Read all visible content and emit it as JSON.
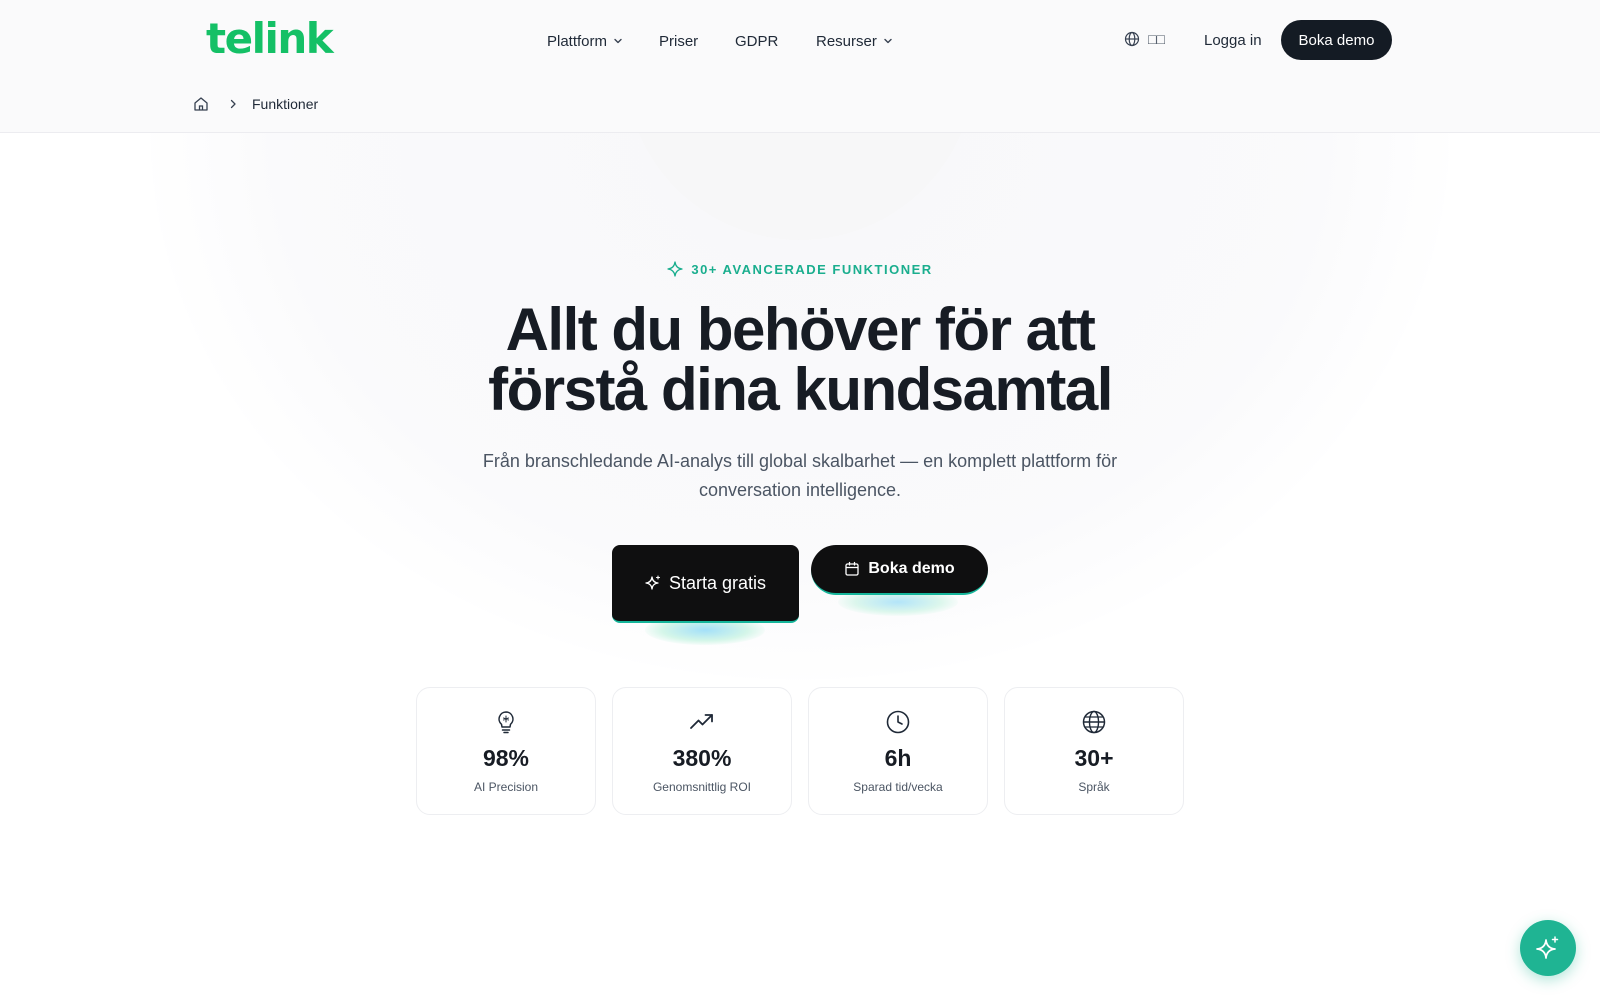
{
  "brand": {
    "logo_text": "telink",
    "color": "#14c066",
    "accent": "#1aae8e"
  },
  "nav": {
    "items": [
      {
        "label": "Plattform",
        "has_dropdown": true
      },
      {
        "label": "Priser",
        "has_dropdown": false
      },
      {
        "label": "GDPR",
        "has_dropdown": false
      },
      {
        "label": "Resurser",
        "has_dropdown": true
      }
    ],
    "language_icon": "globe-icon",
    "language_label": "□□",
    "login_label": "Logga in",
    "demo_label": "Boka demo"
  },
  "breadcrumb": {
    "home_icon": "home-icon",
    "current": "Funktioner"
  },
  "hero": {
    "eyebrow": "30+ AVANCERADE FUNKTIONER",
    "headline_line1": "Allt du behöver för att",
    "headline_line2": "förstå dina kundsamtal",
    "subtitle_line1": "Från branschledande AI-analys till global skalbarhet — en komplett plattform för",
    "subtitle_line2": "conversation intelligence.",
    "cta_primary": "Starta gratis",
    "cta_secondary": "Boka demo"
  },
  "stats": [
    {
      "icon": "lightbulb-icon",
      "value": "98%",
      "label": "AI Precision"
    },
    {
      "icon": "trending-up-icon",
      "value": "380%",
      "label": "Genomsnittlig ROI"
    },
    {
      "icon": "clock-icon",
      "value": "6h",
      "label": "Sparad tid/vecka"
    },
    {
      "icon": "globe-icon",
      "value": "30+",
      "label": "Språk"
    }
  ],
  "fab": {
    "icon": "sparkle-icon",
    "color": "#1fb493"
  }
}
